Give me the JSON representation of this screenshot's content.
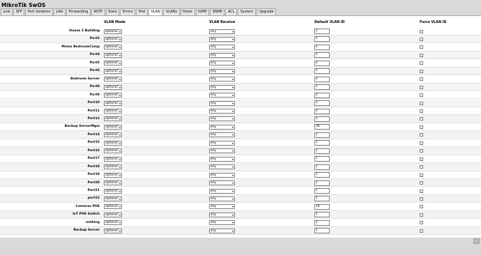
{
  "app": {
    "title": "MikroTik SwOS"
  },
  "tabs": [
    "Link",
    "SFP",
    "Port Isolation",
    "LAG",
    "Forwarding",
    "RSTP",
    "Stats",
    "Errors",
    "Hist",
    "VLAN",
    "VLANs",
    "Hosts",
    "IGMP",
    "SNMP",
    "ACL",
    "System",
    "Upgrade"
  ],
  "active_tab": "VLAN",
  "columns": {
    "mode": "VLAN Mode",
    "receive": "VLAN Receive",
    "default_id": "Default VLAN ID",
    "force": "Force VLAN ID"
  },
  "rows": [
    {
      "name": "House 2 Building",
      "mode": "optional",
      "receive": "any",
      "vlan_id": "1",
      "force": false
    },
    {
      "name": "Port2",
      "mode": "optional",
      "receive": "any",
      "vlan_id": "1",
      "force": false
    },
    {
      "name": "Moms BedroomComp",
      "mode": "optional",
      "receive": "any",
      "vlan_id": "1",
      "force": false
    },
    {
      "name": "Port4",
      "mode": "optional",
      "receive": "any",
      "vlan_id": "1",
      "force": false
    },
    {
      "name": "Port5",
      "mode": "optional",
      "receive": "any",
      "vlan_id": "1",
      "force": false
    },
    {
      "name": "Port6",
      "mode": "optional",
      "receive": "any",
      "vlan_id": "1",
      "force": false
    },
    {
      "name": "Bedroom Server",
      "mode": "optional",
      "receive": "any",
      "vlan_id": "1",
      "force": false
    },
    {
      "name": "Port8",
      "mode": "optional",
      "receive": "any",
      "vlan_id": "1",
      "force": false
    },
    {
      "name": "Port9",
      "mode": "optional",
      "receive": "any",
      "vlan_id": "1",
      "force": false
    },
    {
      "name": "Port10",
      "mode": "optional",
      "receive": "any",
      "vlan_id": "1",
      "force": false
    },
    {
      "name": "Port11",
      "mode": "optional",
      "receive": "any",
      "vlan_id": "1",
      "force": false
    },
    {
      "name": "Port12",
      "mode": "optional",
      "receive": "any",
      "vlan_id": "1",
      "force": false
    },
    {
      "name": "Backup ServerMgm",
      "mode": "optional",
      "receive": "any",
      "vlan_id": "30",
      "force": false
    },
    {
      "name": "Port14",
      "mode": "optional",
      "receive": "any",
      "vlan_id": "1",
      "force": false
    },
    {
      "name": "Port15",
      "mode": "optional",
      "receive": "any",
      "vlan_id": "1",
      "force": false
    },
    {
      "name": "Port16",
      "mode": "optional",
      "receive": "any",
      "vlan_id": "1",
      "force": false
    },
    {
      "name": "Port17",
      "mode": "optional",
      "receive": "any",
      "vlan_id": "1",
      "force": false
    },
    {
      "name": "Port18",
      "mode": "optional",
      "receive": "any",
      "vlan_id": "1",
      "force": false
    },
    {
      "name": "Port19",
      "mode": "optional",
      "receive": "any",
      "vlan_id": "1",
      "force": false
    },
    {
      "name": "Port20",
      "mode": "optional",
      "receive": "any",
      "vlan_id": "1",
      "force": false
    },
    {
      "name": "Port21",
      "mode": "optional",
      "receive": "any",
      "vlan_id": "1",
      "force": false
    },
    {
      "name": "port22",
      "mode": "optional",
      "receive": "any",
      "vlan_id": "1",
      "force": false
    },
    {
      "name": "Cameras POE",
      "mode": "optional",
      "receive": "any",
      "vlan_id": "10",
      "force": false
    },
    {
      "name": "IoT POE Switch",
      "mode": "optional",
      "receive": "any",
      "vlan_id": "1",
      "force": false
    },
    {
      "name": "nothing",
      "mode": "optional",
      "receive": "any",
      "vlan_id": "1",
      "force": false
    },
    {
      "name": "Backup Server",
      "mode": "optional",
      "receive": "any",
      "vlan_id": "1",
      "force": false
    }
  ],
  "icons": {
    "dropdown": "chevron-down-icon"
  }
}
